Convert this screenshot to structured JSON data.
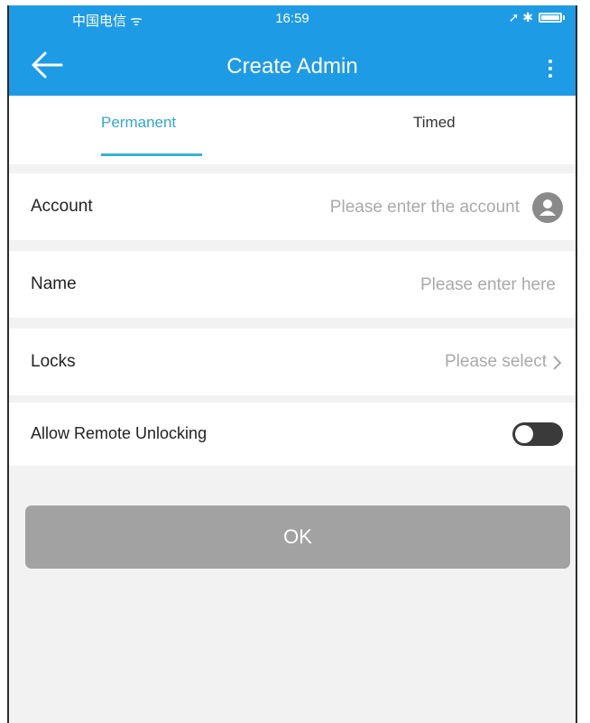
{
  "status_bar": {
    "carrier": "中国电信 ᯤ",
    "time": "16:59",
    "right": "➚ ✱"
  },
  "nav": {
    "title": "Create Admin",
    "back_icon": "arrow-left-icon",
    "more_icon": "more-vertical-icon"
  },
  "tabs": [
    {
      "label": "Permanent",
      "active": true
    },
    {
      "label": "Timed",
      "active": false
    }
  ],
  "form": {
    "account": {
      "label": "Account",
      "placeholder": "Please enter the account",
      "icon": "contact-icon"
    },
    "name": {
      "label": "Name",
      "placeholder": "Please enter here"
    },
    "locks": {
      "label": "Locks",
      "value": "Please select"
    },
    "remote_unlocking": {
      "label": "Allow Remote Unlocking",
      "enabled": false
    }
  },
  "ok_button": {
    "label": "OK"
  },
  "colors": {
    "primary": "#1e9be5",
    "tab_active": "#35a7c9",
    "button_disabled": "#a2a2a2",
    "background": "#f2f2f2"
  }
}
